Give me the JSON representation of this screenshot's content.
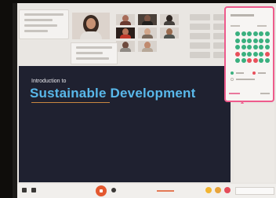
{
  "slide": {
    "intro": "Introduction to",
    "title": "Sustainable Development"
  },
  "colors": {
    "accent": "#ee5b8c",
    "slide_bg": "#1f2130",
    "title": "#59b8ea",
    "record": "#e3582f",
    "seat": "#3ab07f"
  },
  "poll": {
    "seats": {
      "rows": 5,
      "cols": 6,
      "highlighted": [
        [
          3,
          0
        ],
        [
          3,
          5
        ],
        [
          4,
          2
        ],
        [
          4,
          3
        ]
      ]
    }
  },
  "icons": [
    "chat-icon",
    "record-icon",
    "mic-icon",
    "emoji-icon",
    "heart-icon",
    "clap-icon"
  ]
}
